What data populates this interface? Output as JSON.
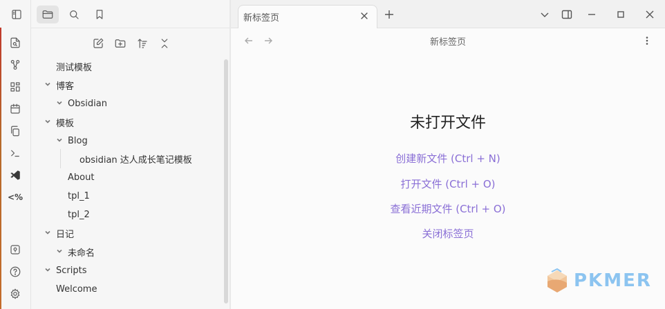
{
  "sidebar_top": {
    "icons": [
      "sidebar-toggle-icon",
      "folder-icon",
      "search-icon",
      "bookmark-icon"
    ]
  },
  "ribbon": {
    "icons": [
      "file-search-icon",
      "graph-icon",
      "grid-icon",
      "calendar-icon",
      "copy-icon",
      "terminal-icon",
      "vscode-icon",
      "code-icon",
      "vault-icon",
      "help-icon",
      "settings-icon"
    ]
  },
  "explorer": {
    "nav_icons": [
      "new-note-icon",
      "new-folder-icon",
      "sort-icon",
      "collapse-icon"
    ],
    "tree": [
      {
        "label": "测试模板"
      },
      {
        "label": "博客"
      },
      {
        "label": "Obsidian"
      },
      {
        "label": "模板"
      },
      {
        "label": "Blog"
      },
      {
        "label": "obsidian 达人成长笔记模板"
      },
      {
        "label": "About"
      },
      {
        "label": "tpl_1"
      },
      {
        "label": "tpl_2"
      },
      {
        "label": "日记"
      },
      {
        "label": "未命名"
      },
      {
        "label": "Scripts"
      },
      {
        "label": "Welcome"
      }
    ]
  },
  "tabbar": {
    "tab_label": "新标签页"
  },
  "view": {
    "title": "新标签页"
  },
  "empty_state": {
    "title": "未打开文件",
    "actions": [
      {
        "label": "创建新文件 (Ctrl + N)"
      },
      {
        "label": "打开文件 (Ctrl + O)"
      },
      {
        "label": "查看近期文件 (Ctrl + O)"
      },
      {
        "label": "关闭标签页"
      }
    ]
  },
  "watermark": {
    "text": "PKMER"
  },
  "colors": {
    "accent": "#8a6fd6",
    "watermark": "#8cc4f0"
  }
}
